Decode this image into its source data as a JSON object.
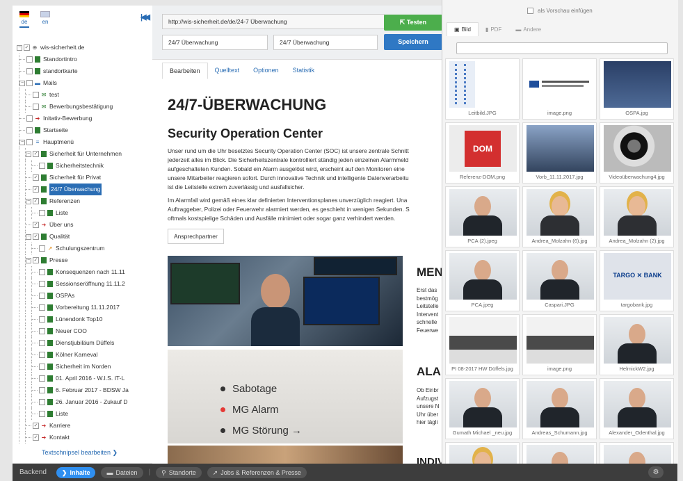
{
  "languages": [
    {
      "code": "de",
      "active": true
    },
    {
      "code": "en",
      "active": false
    }
  ],
  "tree": [
    {
      "label": "wis-sicherheit.de",
      "indent": 0,
      "exp": "−",
      "checked": true,
      "icon": "globe-icon"
    },
    {
      "label": "Standortintro",
      "indent": 1,
      "icon": "page-icon"
    },
    {
      "label": "standortkarte",
      "indent": 1,
      "icon": "page-icon"
    },
    {
      "label": "Mails",
      "indent": 1,
      "exp": "−",
      "icon": "folder-icon"
    },
    {
      "label": "test",
      "indent": 2,
      "icon": "mail-icon"
    },
    {
      "label": "Bewerbungsbestätigung",
      "indent": 2,
      "icon": "mail-icon"
    },
    {
      "label": "Initativ-Bewerbung",
      "indent": 1,
      "icon": "link-arrow-icon"
    },
    {
      "label": "Startseite",
      "indent": 1,
      "icon": "page-icon"
    },
    {
      "label": "Hauptmenü",
      "indent": 1,
      "exp": "−",
      "icon": "menu-icon"
    },
    {
      "label": "Sicherheit für Unternehmen",
      "indent": 2,
      "exp": "−",
      "checked": true,
      "icon": "page-icon"
    },
    {
      "label": "Sicherheitstechnik",
      "indent": 3,
      "icon": "page-icon"
    },
    {
      "label": "Sicherheit für Privat",
      "indent": 2,
      "checked": true,
      "icon": "page-icon"
    },
    {
      "label": "24/7 Überwachung",
      "indent": 2,
      "checked": true,
      "icon": "page-icon",
      "selected": true
    },
    {
      "label": "Referenzen",
      "indent": 2,
      "exp": "−",
      "checked": true,
      "icon": "page-icon"
    },
    {
      "label": "Liste",
      "indent": 3,
      "icon": "page-icon"
    },
    {
      "label": "Über uns",
      "indent": 2,
      "checked": true,
      "icon": "link-arrow-icon"
    },
    {
      "label": "Qualität",
      "indent": 2,
      "exp": "−",
      "checked": true,
      "icon": "page-icon"
    },
    {
      "label": "Schulungszentrum",
      "indent": 3,
      "icon": "external-link-icon"
    },
    {
      "label": "Presse",
      "indent": 2,
      "exp": "−",
      "checked": true,
      "icon": "page-icon"
    },
    {
      "label": "Konsequenzen nach 11.11",
      "indent": 3,
      "icon": "page-icon"
    },
    {
      "label": "Sessionseröffnung 11.11.2",
      "indent": 3,
      "icon": "page-icon"
    },
    {
      "label": "OSPAs",
      "indent": 3,
      "icon": "page-icon"
    },
    {
      "label": "Vorbereitung 11.11.2017",
      "indent": 3,
      "icon": "page-icon"
    },
    {
      "label": "Lünendonk Top10",
      "indent": 3,
      "icon": "page-icon"
    },
    {
      "label": "Neuer COO",
      "indent": 3,
      "icon": "page-icon"
    },
    {
      "label": "Dienstjubiläum Düffels",
      "indent": 3,
      "icon": "page-icon"
    },
    {
      "label": "Kölner Karneval",
      "indent": 3,
      "icon": "page-icon"
    },
    {
      "label": "Sicherheit im Norden",
      "indent": 3,
      "icon": "page-icon"
    },
    {
      "label": "01. April 2016 - W.I.S. IT-L",
      "indent": 3,
      "icon": "page-icon"
    },
    {
      "label": "6. Februar 2017 - BDSW Ja",
      "indent": 3,
      "icon": "page-icon"
    },
    {
      "label": "26. Januar 2016 - Zukauf D",
      "indent": 3,
      "icon": "page-icon"
    },
    {
      "label": "Liste",
      "indent": 3,
      "icon": "page-icon"
    },
    {
      "label": "Karriere",
      "indent": 2,
      "checked": true,
      "icon": "link-arrow-icon"
    },
    {
      "label": "Kontakt",
      "indent": 2,
      "checked": true,
      "icon": "link-arrow-icon"
    }
  ],
  "snippet_link": "Textschnipsel bearbeiten ❯",
  "editor": {
    "url": "http://wis-sicherheit.de/de/24-7 Überwachung",
    "title1": "24/7 Überwachung",
    "title2": "24/7 Überwachung",
    "test_label": "Testen",
    "save_label": "Speichern",
    "tabs": [
      "Bearbeiten",
      "Quelltext",
      "Optionen",
      "Statistik"
    ],
    "h1": "24/7-ÜBERWACHUNG",
    "h2": "Security Operation Center",
    "para1": [
      "Unser rund um die Uhr besetztes Security Operation Center (SOC) ist unsere zentrale Schnitt",
      "jederzeit alles im Blick. Die Sicherheitszentrale kontrolliert ständig jeden einzelnen Alarmmeld",
      "aufgeschalteten Kunden. Sobald ein Alarm ausgelöst wird, erscheint auf den Monitoren eine",
      "unsere Mitarbeiter reagieren sofort. Durch innovative Technik und intelligente Datenverarbeitu",
      "ist die Leitstelle extrem zuverlässig und ausfallsicher."
    ],
    "para2": [
      "Im Alarmfall wird gemäß eines klar definierten Interventionsplanes unverzüglich reagiert. Una",
      "Auftraggeber, Polizei oder Feuerwehr alarmiert werden, es geschieht in wenigen Sekunden. S",
      "oftmals kostspielige Schäden und Ausfälle minimiert oder sogar ganz verhindert werden."
    ],
    "contact_button": "Ansprechpartner",
    "panel_labels": [
      "Sabotage",
      "MG Alarm",
      "MG Störung →"
    ],
    "side_heading1": "MEN",
    "side_text1": "Erst das\nbestmög\nLeitstelle\nIntervent\nschnelle\nFeuerwe",
    "side_heading2": "ALA",
    "side_text2": "Ob Einbr\nAufzugst\nunsere N\nUhr über\nhier tägli",
    "side_heading3": "INDIVIDUELLEN PERZUGRIFF"
  },
  "media": {
    "preview_label": "als Vorschau einfügen",
    "tabs": [
      "Bild",
      "PDF",
      "Andere"
    ],
    "files": [
      {
        "name": "Leitbild.JPG",
        "kind": "dna"
      },
      {
        "name": "image.png",
        "kind": "ihk"
      },
      {
        "name": "OSPA.jpg",
        "kind": "group"
      },
      {
        "name": "Referenz-DOM.png",
        "kind": "dom"
      },
      {
        "name": "Vorb_11.11.2017.jpg",
        "kind": "crowd"
      },
      {
        "name": "Videoüberwachung4.jpg",
        "kind": "camera"
      },
      {
        "name": "PCA (2).jpeg",
        "kind": "man"
      },
      {
        "name": "Andrea_Molzahn (6).jpg",
        "kind": "woman"
      },
      {
        "name": "Andrea_Molzahn (2).jpg",
        "kind": "woman"
      },
      {
        "name": "PCA.jpeg",
        "kind": "man"
      },
      {
        "name": "Caspari.JPG",
        "kind": "man"
      },
      {
        "name": "targobank.jpg",
        "kind": "targo"
      },
      {
        "name": "PI 08-2017 HW Düffels.jpg",
        "kind": "meeting"
      },
      {
        "name": "image.png",
        "kind": "meeting"
      },
      {
        "name": "HelmickW2.jpg",
        "kind": "man"
      },
      {
        "name": "Gumath Michael _neu.jpg",
        "kind": "man"
      },
      {
        "name": "Andreas_Schumann.jpg",
        "kind": "man"
      },
      {
        "name": "Alexander_Odenthal.jpg",
        "kind": "man"
      },
      {
        "name": "",
        "kind": "woman"
      },
      {
        "name": "",
        "kind": "man"
      },
      {
        "name": "",
        "kind": "man"
      }
    ],
    "targobank_logo": "TARGO ✕ BANK",
    "dom_logo": "DOM"
  },
  "bottombar": {
    "label": "Backend",
    "items": [
      {
        "label": "Inhalte",
        "icon": "chevron-right-icon",
        "active": true
      },
      {
        "label": "Dateien",
        "icon": "folder-icon",
        "active": false
      },
      {
        "label": "Standorte",
        "icon": "map-pin-icon",
        "active": false
      },
      {
        "label": "Jobs & Referenzen & Presse",
        "icon": "rocket-icon",
        "active": false
      }
    ]
  }
}
